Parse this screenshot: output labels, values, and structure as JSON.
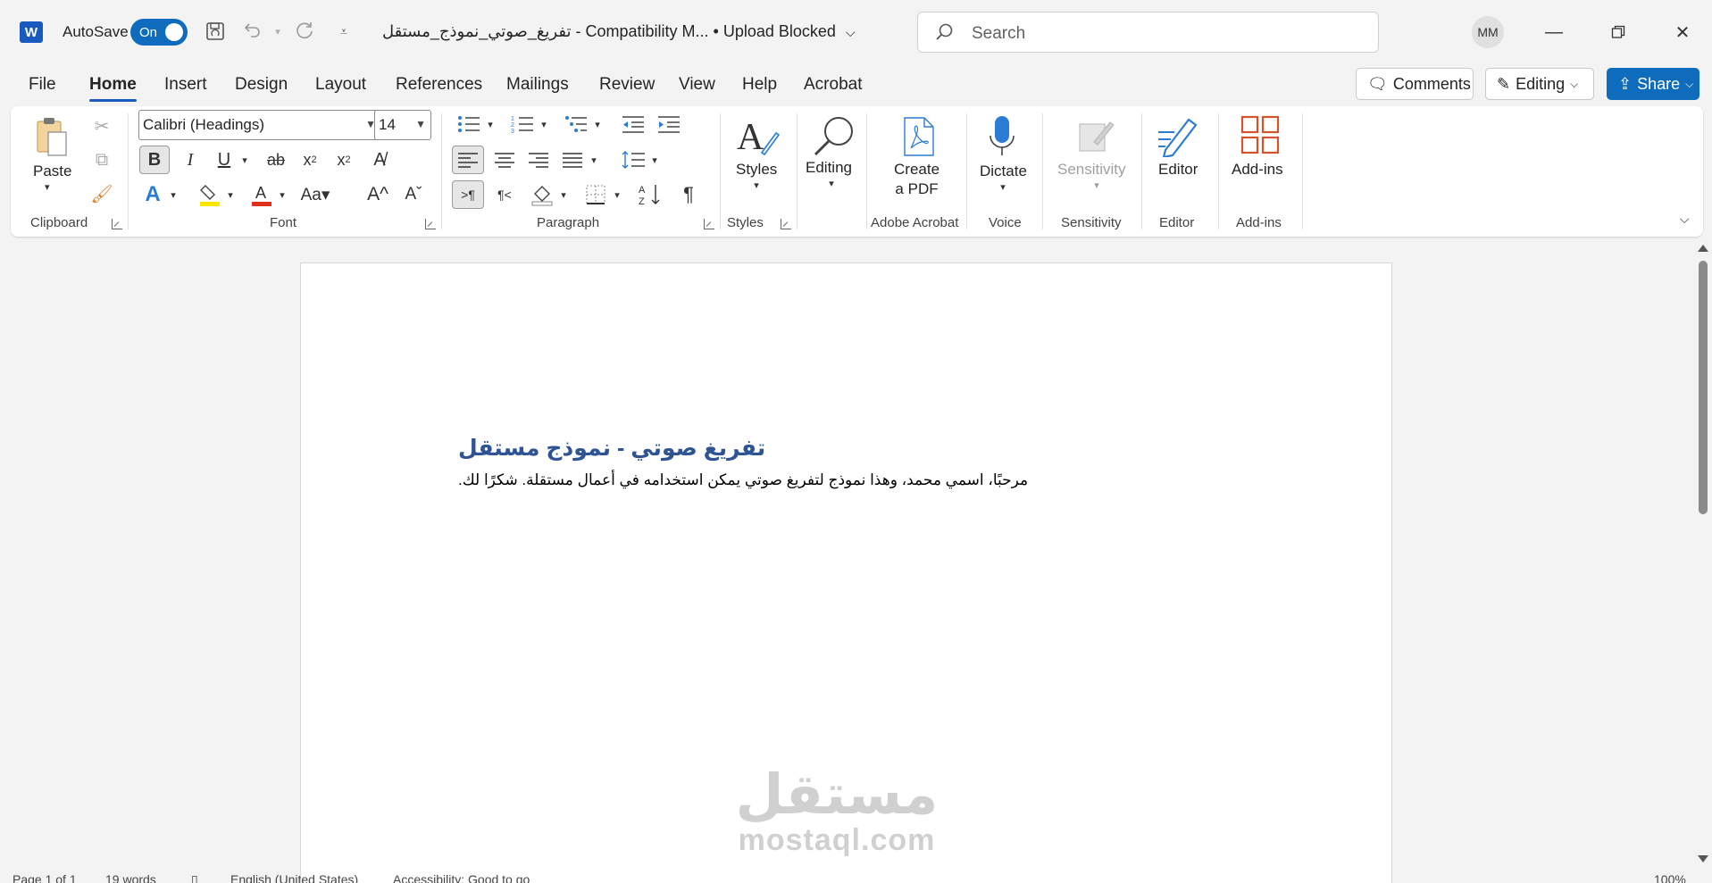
{
  "titlebar": {
    "autosave_label": "AutoSave",
    "autosave_state": "On",
    "doc_title": "تفريغ_صوتي_نموذج_مستقل  -  Compatibility M...  •  Upload Blocked",
    "search_placeholder": "Search",
    "user_initials": "MM"
  },
  "menu": {
    "tabs": [
      "File",
      "Home",
      "Insert",
      "Design",
      "Layout",
      "References",
      "Mailings",
      "Review",
      "View",
      "Help",
      "Acrobat"
    ],
    "active": "Home",
    "comments_label": "Comments",
    "editing_label": "Editing",
    "share_label": "Share"
  },
  "ribbon": {
    "paste_label": "Paste",
    "font_name": "Calibri (Headings)",
    "font_size": "14",
    "styles_label": "Styles",
    "editing_label": "Editing",
    "create_pdf_line1": "Create",
    "create_pdf_line2": "a PDF",
    "dictate_label": "Dictate",
    "sensitivity_label": "Sensitivity",
    "editor_label": "Editor",
    "addins_label": "Add-ins",
    "groups": {
      "clipboard": "Clipboard",
      "font": "Font",
      "paragraph": "Paragraph",
      "styles": "Styles",
      "adobe": "Adobe Acrobat",
      "voice": "Voice",
      "sensitivity": "Sensitivity",
      "editor": "Editor",
      "addins": "Add-ins"
    }
  },
  "document": {
    "heading": "تفريغ صوتي - نموذج مستقل",
    "body": "مرحبًا، اسمي محمد، وهذا نموذج لتفريغ صوتي يمكن استخدامه في أعمال مستقلة. شكرًا لك.",
    "watermark_ar": "مستقل",
    "watermark_en": "mostaql.com"
  },
  "status": {
    "page_info": "Page 1 of 1",
    "word_count": "19 words",
    "language": "English (United States)",
    "accessibility": "Accessibility: Good to go",
    "zoom": "100%"
  },
  "colors": {
    "accent": "#0f6cbd",
    "word_blue": "#185abd",
    "heading_blue": "#2f5496"
  }
}
